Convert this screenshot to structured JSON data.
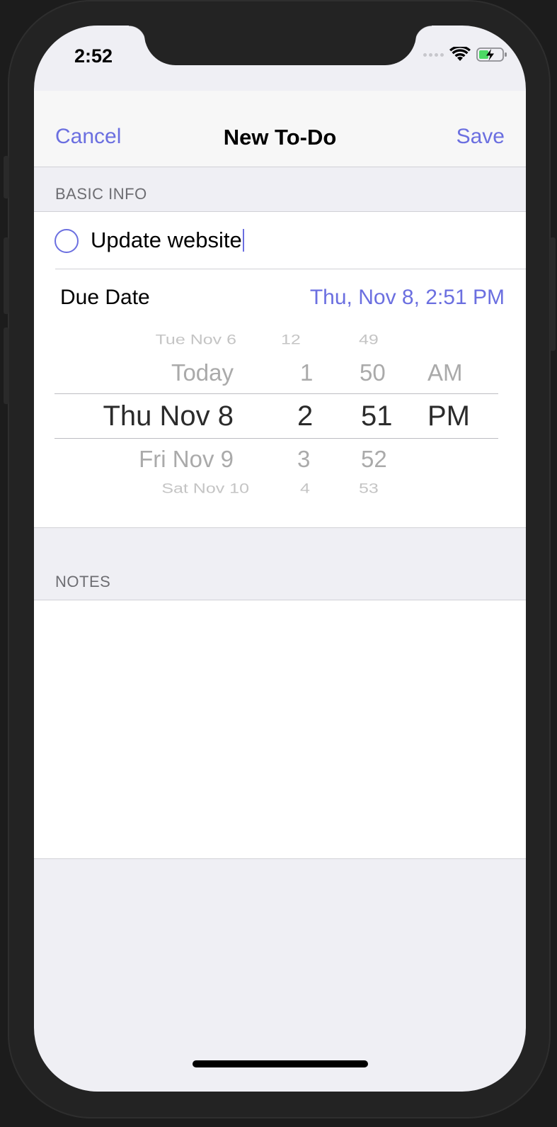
{
  "status_bar": {
    "time": "2:52"
  },
  "nav": {
    "cancel": "Cancel",
    "title": "New To-Do",
    "save": "Save"
  },
  "sections": {
    "basic_info": "BASIC INFO",
    "notes": "NOTES"
  },
  "todo": {
    "title": "Update website"
  },
  "due_date": {
    "label": "Due Date",
    "value": "Thu, Nov 8, 2:51 PM"
  },
  "picker": {
    "dates": [
      "Tue Nov 6",
      "Today",
      "Thu Nov 8",
      "Fri Nov 9",
      "Sat Nov 10"
    ],
    "hours": [
      "12",
      "1",
      "2",
      "3",
      "4"
    ],
    "minutes": [
      "49",
      "50",
      "51",
      "52",
      "53"
    ],
    "ampm": [
      "AM",
      "PM"
    ]
  },
  "colors": {
    "accent": "#6b6fe0",
    "background": "#efeff4"
  }
}
